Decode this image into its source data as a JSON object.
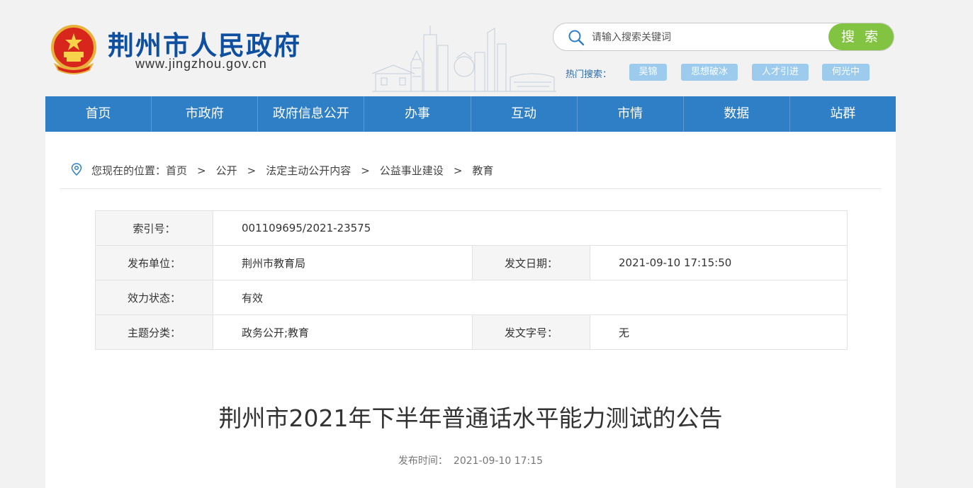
{
  "header": {
    "site_title": "荆州市人民政府",
    "site_url": "www.jingzhou.gov.cn"
  },
  "search": {
    "placeholder": "请输入搜索关键词",
    "button_label": "搜 索",
    "hot_label": "热门搜索：",
    "hot_tags": [
      "吴锦",
      "思想破冰",
      "人才引进",
      "何光中"
    ]
  },
  "nav": {
    "items": [
      "首页",
      "市政府",
      "政府信息公开",
      "办事",
      "互动",
      "市情",
      "数据",
      "站群"
    ]
  },
  "breadcrumb": {
    "prefix": "您现在的位置：",
    "items": [
      "首页",
      "公开",
      "法定主动公开内容",
      "公益事业建设",
      "教育"
    ],
    "separator": ">"
  },
  "info_table": {
    "index_label": "索引号：",
    "index_value": "001109695/2021-23575",
    "publisher_label": "发布单位：",
    "publisher_value": "荆州市教育局",
    "date_label": "发文日期：",
    "date_value": "2021-09-10 17:15:50",
    "status_label": "效力状态：",
    "status_value": "有效",
    "topic_label": "主题分类：",
    "topic_value": "政务公开;教育",
    "docno_label": "发文字号：",
    "docno_value": "无"
  },
  "article": {
    "title": "荆州市2021年下半年普通话水平能力测试的公告",
    "publish_label": "发布时间：",
    "publish_time": "2021-09-10 17:15"
  },
  "colors": {
    "nav_bg": "#2f7fc7",
    "title_blue": "#0f4fa0",
    "search_button": "#82c441",
    "hot_tag_bg": "#9ccbed"
  }
}
